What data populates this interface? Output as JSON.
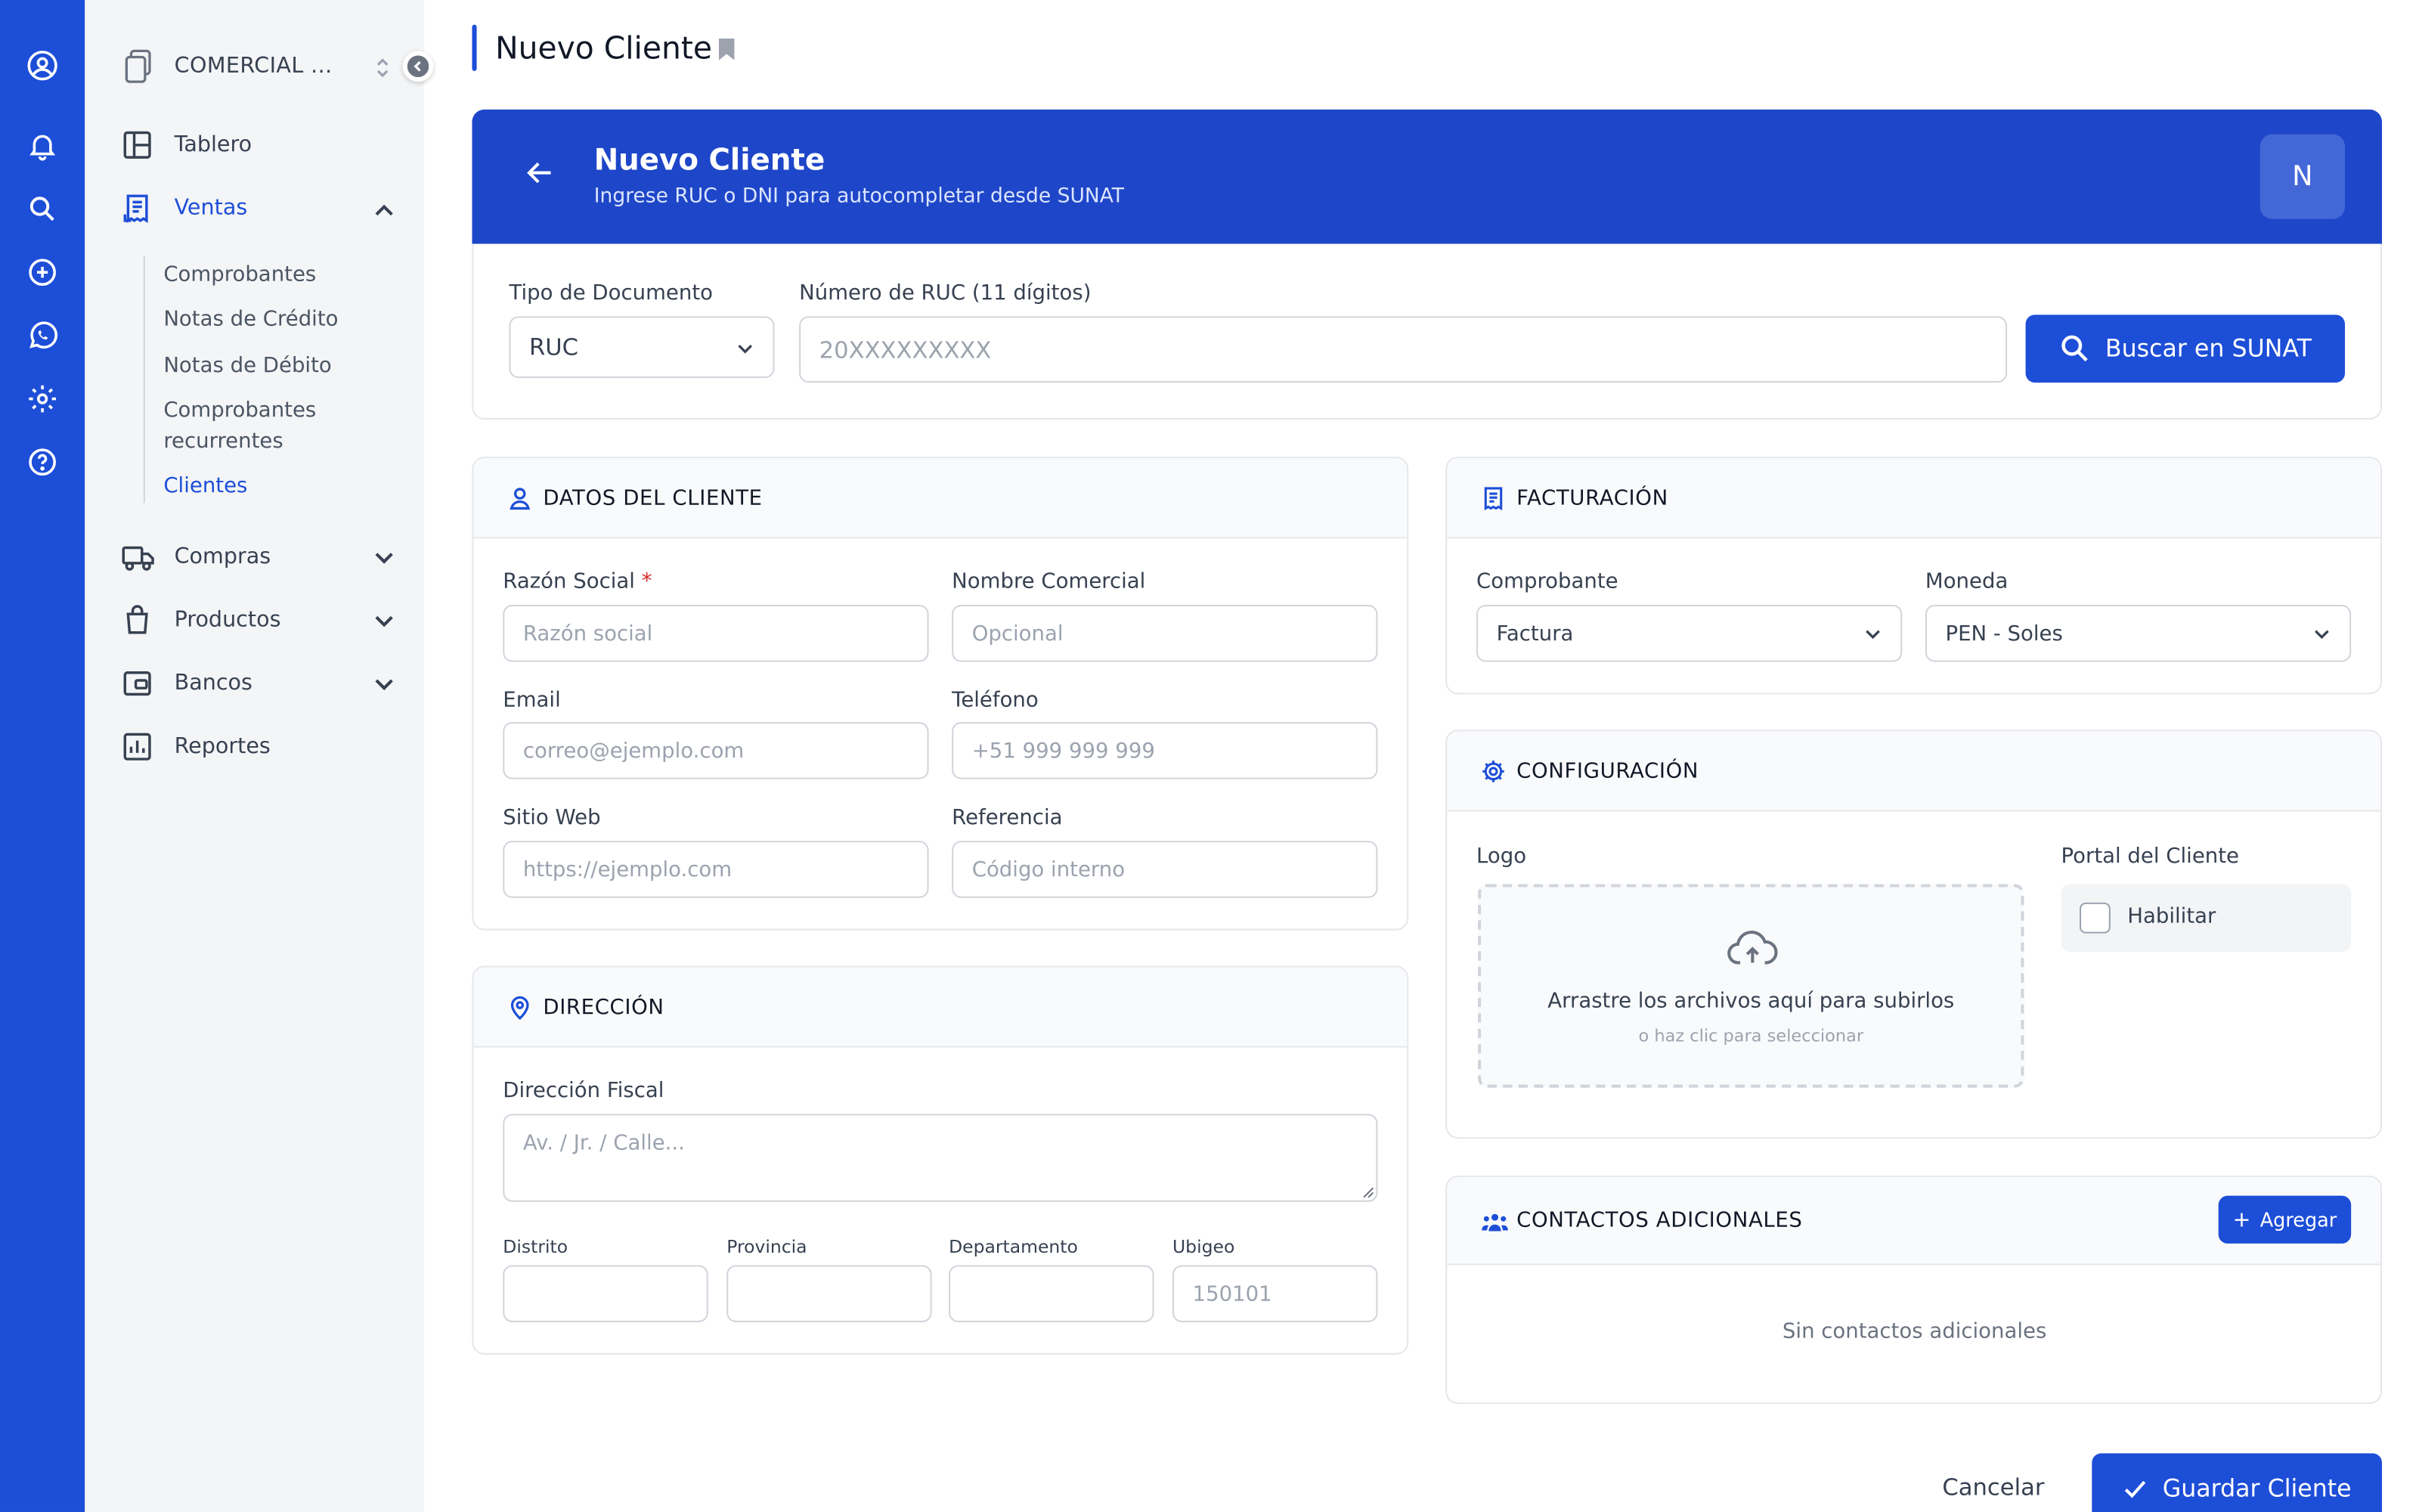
{
  "rail": {
    "icons": [
      "user-circle-icon",
      "bell-icon",
      "search-icon",
      "plus-circle-icon",
      "whatsapp-icon",
      "gear-icon",
      "help-icon"
    ]
  },
  "sidebar": {
    "company": "COMERCIAL ...",
    "items": [
      {
        "label": "Tablero"
      },
      {
        "label": "Ventas"
      },
      {
        "label": "Compras"
      },
      {
        "label": "Productos"
      },
      {
        "label": "Bancos"
      },
      {
        "label": "Reportes"
      }
    ],
    "ventas_sub": [
      "Comprobantes",
      "Notas de Crédito",
      "Notas de Débito",
      "Comprobantes recurrentes",
      "Clientes"
    ],
    "active_color": "#1d4ed8"
  },
  "page": {
    "title": "Nuevo Cliente"
  },
  "hero": {
    "title": "Nuevo Cliente",
    "subtitle": "Ingrese RUC o DNI para autocompletar desde SUNAT",
    "avatar": "N",
    "color": "#1e46c8"
  },
  "search": {
    "doc_type_label": "Tipo de Documento",
    "doc_type_value": "RUC",
    "ruc_label": "Número de RUC (11 dígitos)",
    "ruc_placeholder": "20XXXXXXXXX",
    "button": "Buscar en SUNAT"
  },
  "cliente": {
    "title": "DATOS DEL CLIENTE",
    "razon_label": "Razón Social",
    "razon_req": "*",
    "razon_placeholder": "Razón social",
    "nombre_label": "Nombre Comercial",
    "nombre_placeholder": "Opcional",
    "email_label": "Email",
    "email_placeholder": "correo@ejemplo.com",
    "telefono_label": "Teléfono",
    "telefono_placeholder": "+51 999 999 999",
    "web_label": "Sitio Web",
    "web_placeholder": "https://ejemplo.com",
    "ref_label": "Referencia",
    "ref_placeholder": "Código interno"
  },
  "direccion": {
    "title": "DIRECCIÓN",
    "fiscal_label": "Dirección Fiscal",
    "fiscal_placeholder": "Av. / Jr. / Calle...",
    "distrito_label": "Distrito",
    "provincia_label": "Provincia",
    "departamento_label": "Departamento",
    "ubigeo_label": "Ubigeo",
    "ubigeo_placeholder": "150101"
  },
  "facturacion": {
    "title": "FACTURACIÓN",
    "comprobante_label": "Comprobante",
    "comprobante_value": "Factura",
    "moneda_label": "Moneda",
    "moneda_value": "PEN - Soles"
  },
  "config": {
    "title": "CONFIGURACIÓN",
    "logo_label": "Logo",
    "drop_text": "Arrastre los archivos aquí para subirlos",
    "drop_sub": "o haz clic para seleccionar",
    "portal_label": "Portal del Cliente",
    "portal_check": "Habilitar"
  },
  "contactos": {
    "title": "CONTACTOS ADICIONALES",
    "add": "Agregar",
    "empty": "Sin contactos adicionales"
  },
  "footer": {
    "cancel": "Cancelar",
    "save": "Guardar Cliente"
  }
}
